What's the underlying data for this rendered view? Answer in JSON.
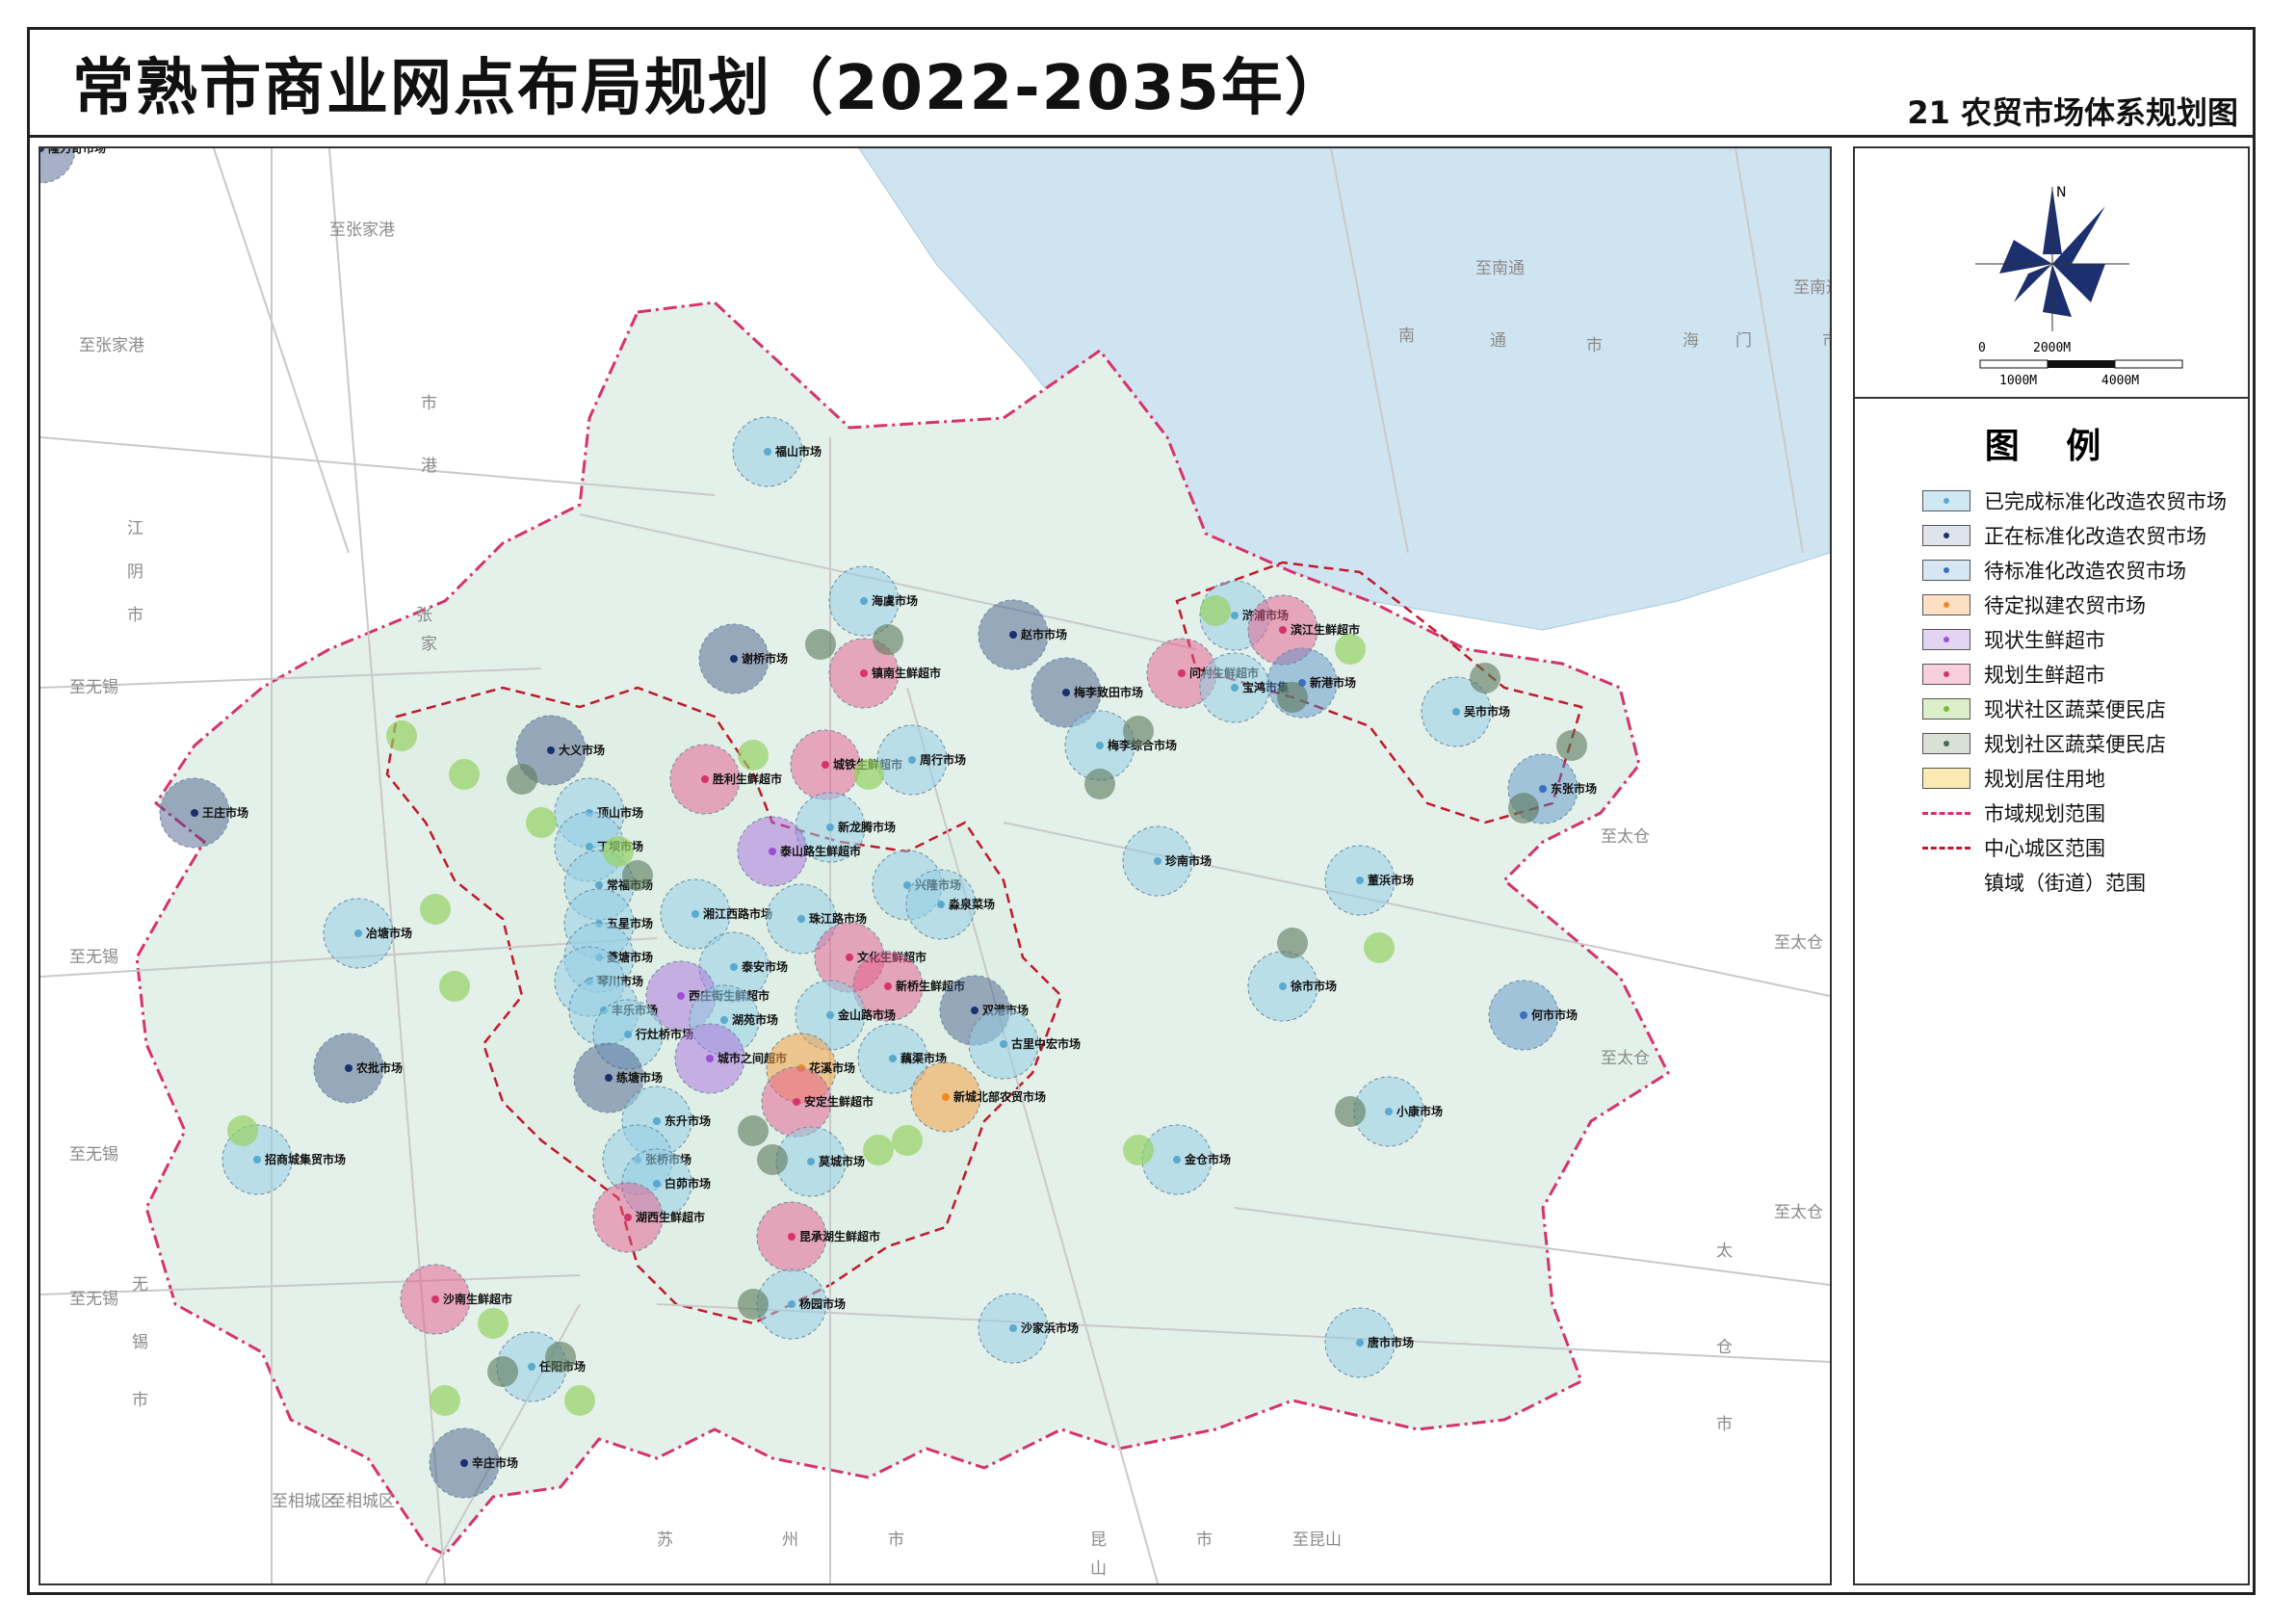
{
  "title": "常熟市商业网点布局规划（2022-2035年）",
  "subtitle": "21 农贸市场体系规划图",
  "legend": {
    "title": "图 例",
    "items": [
      {
        "label": "已完成标准化改造农贸市场",
        "fill": "#cfe8f3",
        "dot": "#5aa9cf"
      },
      {
        "label": "正在标准化改造农贸市场",
        "fill": "#dfe3ec",
        "dot": "#1c2f6e"
      },
      {
        "label": "待标准化改造农贸市场",
        "fill": "#d6e6f3",
        "dot": "#3b6fc0"
      },
      {
        "label": "待定拟建农贸市场",
        "fill": "#fde0c4",
        "dot": "#f08a1f"
      },
      {
        "label": "现状生鲜超市",
        "fill": "#e4d4f3",
        "dot": "#9d4fd6"
      },
      {
        "label": "规划生鲜超市",
        "fill": "#f8d0dd",
        "dot": "#d6336c"
      },
      {
        "label": "现状社区蔬菜便民店",
        "fill": "#dcefc8",
        "dot": "#7dbb3b"
      },
      {
        "label": "规划社区蔬菜便民店",
        "fill": "#d9e0d6",
        "dot": "#4c6b4c"
      },
      {
        "label": "规划居住用地",
        "fill": "#fbeab2",
        "dot": ""
      },
      {
        "label": "市域规划范围",
        "line": "#d6336c",
        "style": "dashdot"
      },
      {
        "label": "中心城区范围",
        "line": "#c0192c",
        "style": "dashed"
      },
      {
        "label": "镇域（街道）范围",
        "line": "",
        "style": "none"
      }
    ]
  },
  "scale": {
    "t1": "0",
    "t2": "2000M",
    "t3": "1000M",
    "t4": "4000M"
  },
  "north": "N",
  "colors": {
    "completed": "#5aa9cf",
    "ongoing": "#1c2f6e",
    "pending": "#3b6fc0",
    "proposed": "#f08a1f",
    "super_exist": "#9d4fd6",
    "super_plan": "#d6336c",
    "shop_exist": "#7dbb3b",
    "shop_plan": "#4c6b4c"
  },
  "markets": [
    {
      "name": "福山市场",
      "type": "completed"
    },
    {
      "name": "海虞市场",
      "type": "completed"
    },
    {
      "name": "镇南生鲜超市",
      "type": "super_plan"
    },
    {
      "name": "赵市市场",
      "type": "ongoing"
    },
    {
      "name": "谢桥市场",
      "type": "ongoing"
    },
    {
      "name": "梅李致田市场",
      "type": "ongoing"
    },
    {
      "name": "梅李综合市场",
      "type": "completed"
    },
    {
      "name": "浒浦市场",
      "type": "completed"
    },
    {
      "name": "滨江生鲜超市",
      "type": "super_plan"
    },
    {
      "name": "问村生鲜超市",
      "type": "super_plan"
    },
    {
      "name": "宝鸿市集",
      "type": "completed"
    },
    {
      "name": "新港市场",
      "type": "pending"
    },
    {
      "name": "吴市市场",
      "type": "completed"
    },
    {
      "name": "东张市场",
      "type": "pending"
    },
    {
      "name": "大义市场",
      "type": "ongoing"
    },
    {
      "name": "王庄市场",
      "type": "ongoing"
    },
    {
      "name": "胜利生鲜超市",
      "type": "super_plan"
    },
    {
      "name": "城铁生鲜超市",
      "type": "super_plan"
    },
    {
      "name": "周行市场",
      "type": "completed"
    },
    {
      "name": "顶山市场",
      "type": "completed"
    },
    {
      "name": "丁坝市场",
      "type": "completed"
    },
    {
      "name": "新龙腾市场",
      "type": "completed"
    },
    {
      "name": "泰山路生鲜超市",
      "type": "super_exist"
    },
    {
      "name": "常福市场",
      "type": "completed"
    },
    {
      "name": "兴隆市场",
      "type": "completed"
    },
    {
      "name": "淼泉菜场",
      "type": "completed"
    },
    {
      "name": "珍南市场",
      "type": "completed"
    },
    {
      "name": "董浜市场",
      "type": "completed"
    },
    {
      "name": "五星市场",
      "type": "completed"
    },
    {
      "name": "湘江西路市场",
      "type": "completed"
    },
    {
      "name": "珠江路市场",
      "type": "completed"
    },
    {
      "name": "冶塘市场",
      "type": "completed"
    },
    {
      "name": "菱塘市场",
      "type": "completed"
    },
    {
      "name": "文化生鲜超市",
      "type": "super_plan"
    },
    {
      "name": "泰安市场",
      "type": "completed"
    },
    {
      "name": "琴川市场",
      "type": "completed"
    },
    {
      "name": "新桥生鲜超市",
      "type": "super_plan"
    },
    {
      "name": "西庄街生鲜超市",
      "type": "super_exist"
    },
    {
      "name": "徐市市场",
      "type": "completed"
    },
    {
      "name": "丰乐市场",
      "type": "completed"
    },
    {
      "name": "湖苑市场",
      "type": "completed"
    },
    {
      "name": "金山路市场",
      "type": "completed"
    },
    {
      "name": "双港市场",
      "type": "ongoing"
    },
    {
      "name": "行灶桥市场",
      "type": "completed"
    },
    {
      "name": "何市市场",
      "type": "pending"
    },
    {
      "name": "古里中宏市场",
      "type": "completed"
    },
    {
      "name": "城市之间超市",
      "type": "super_exist"
    },
    {
      "name": "花溪市场",
      "type": "proposed"
    },
    {
      "name": "藕渠市场",
      "type": "completed"
    },
    {
      "name": "农批市场",
      "type": "ongoing"
    },
    {
      "name": "练塘市场",
      "type": "ongoing"
    },
    {
      "name": "安定生鲜超市",
      "type": "super_plan"
    },
    {
      "name": "新城北部农贸市场",
      "type": "proposed"
    },
    {
      "name": "小康市场",
      "type": "completed"
    },
    {
      "name": "东升市场",
      "type": "completed"
    },
    {
      "name": "招商城集贸市场",
      "type": "completed"
    },
    {
      "name": "张桥市场",
      "type": "completed"
    },
    {
      "name": "莫城市场",
      "type": "completed"
    },
    {
      "name": "金仓市场",
      "type": "completed"
    },
    {
      "name": "白茆市场",
      "type": "completed"
    },
    {
      "name": "湖西生鲜超市",
      "type": "super_plan"
    },
    {
      "name": "昆承湖生鲜超市",
      "type": "super_plan"
    },
    {
      "name": "沙南生鲜超市",
      "type": "super_plan"
    },
    {
      "name": "杨园市场",
      "type": "completed"
    },
    {
      "name": "沙家浜市场",
      "type": "completed"
    },
    {
      "name": "唐市市场",
      "type": "completed"
    },
    {
      "name": "任阳市场",
      "type": "completed"
    },
    {
      "name": "辛庄市场",
      "type": "ongoing"
    },
    {
      "name": "隆力奇市场",
      "type": "ongoing"
    }
  ],
  "geo_labels": [
    "至张家港",
    "至张家港",
    "江",
    "阴",
    "市",
    "至无锡",
    "至无锡",
    "至无锡",
    "至无锡",
    "无",
    "锡",
    "市",
    "至相城区",
    "至相城区",
    "苏",
    "州",
    "市",
    "昆",
    "山",
    "市",
    "至昆山",
    "至太仓",
    "至太仓",
    "至太仓",
    "至太仓",
    "太",
    "仓",
    "市",
    "南",
    "通",
    "市",
    "海",
    "门",
    "市",
    "至南通",
    "至南通",
    "张",
    "家",
    "港",
    "市"
  ]
}
